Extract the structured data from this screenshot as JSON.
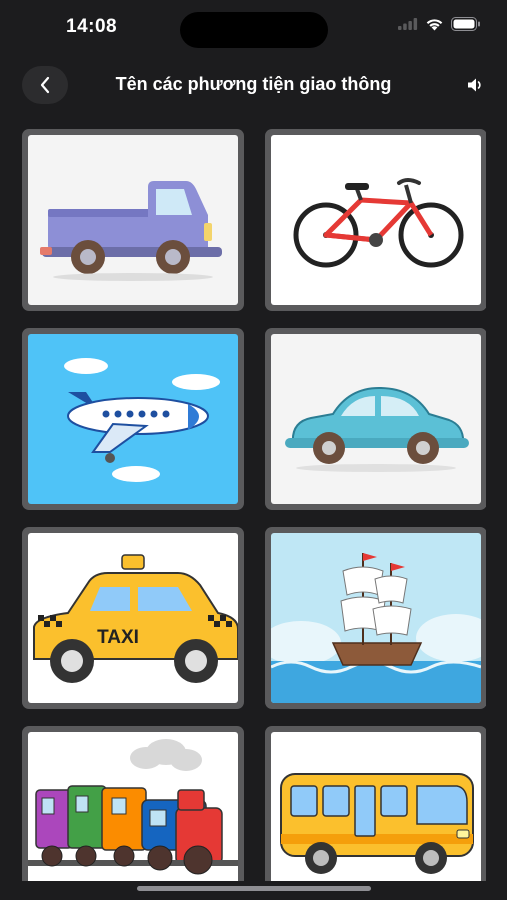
{
  "status_bar": {
    "time": "14:08",
    "icons": [
      "signal-icon",
      "wifi-icon",
      "battery-icon"
    ]
  },
  "nav": {
    "back_icon": "chevron-left-icon",
    "title": "Tên các phương tiện giao thông",
    "speaker_icon": "speaker-icon"
  },
  "vehicles": [
    {
      "id": "pickup-truck",
      "icon": "pickup-truck-icon",
      "background": "#ffffff"
    },
    {
      "id": "bicycle",
      "icon": "bicycle-icon",
      "background": "#ffffff"
    },
    {
      "id": "airplane",
      "icon": "airplane-icon",
      "background": "#4fc3f7"
    },
    {
      "id": "car",
      "icon": "car-icon",
      "background": "#ffffff"
    },
    {
      "id": "taxi",
      "icon": "taxi-icon",
      "background": "#ffffff",
      "sign_text": "TAXI"
    },
    {
      "id": "sailing-ship",
      "icon": "sailing-ship-icon",
      "background": "#bfe7f5"
    },
    {
      "id": "train",
      "icon": "train-icon",
      "background": "#ffffff"
    },
    {
      "id": "bus",
      "icon": "bus-icon",
      "background": "#ffffff"
    }
  ],
  "colors": {
    "background": "#1c1c1e",
    "card_border": "#5a5a5c",
    "title": "#ffffff"
  }
}
